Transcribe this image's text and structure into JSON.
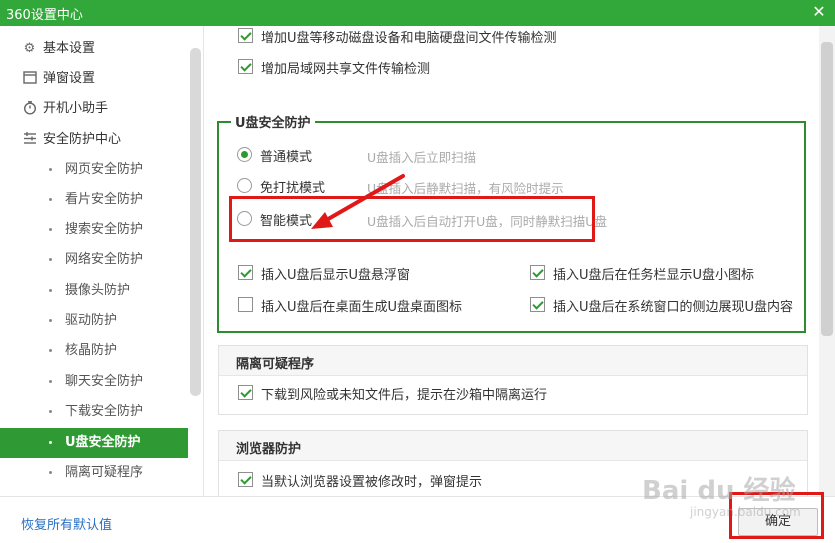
{
  "window": {
    "title": "360设置中心",
    "close_glyph": "✕"
  },
  "sidebar": {
    "top_items": [
      {
        "label": "基本设置",
        "icon": "gear-icon"
      },
      {
        "label": "弹窗设置",
        "icon": "window-icon"
      },
      {
        "label": "开机小助手",
        "icon": "power-timer-icon"
      },
      {
        "label": "安全防护中心",
        "icon": "list-icon"
      }
    ],
    "sub_items": [
      {
        "label": "网页安全防护"
      },
      {
        "label": "看片安全防护"
      },
      {
        "label": "搜索安全防护"
      },
      {
        "label": "网络安全防护"
      },
      {
        "label": "摄像头防护"
      },
      {
        "label": "驱动防护"
      },
      {
        "label": "核晶防护"
      },
      {
        "label": "聊天安全防护"
      },
      {
        "label": "下载安全防护"
      },
      {
        "label": "U盘安全防护",
        "active": true
      },
      {
        "label": "隔离可疑程序"
      }
    ]
  },
  "main": {
    "top_options": [
      {
        "label": "增加U盘等移动磁盘设备和电脑硬盘间文件传输检测",
        "checked": true
      },
      {
        "label": "增加局域网共享文件传输检测",
        "checked": true
      }
    ],
    "usb": {
      "title": "U盘安全防护",
      "modes": [
        {
          "label": "普通模式",
          "hint": "U盘插入后立即扫描",
          "selected": true
        },
        {
          "label": "免打扰模式",
          "hint": "U盘插入后静默扫描，有风险时提示",
          "selected": false
        },
        {
          "label": "智能模式",
          "hint": "U盘插入后自动打开U盘，同时静默扫描U盘",
          "selected": false
        }
      ],
      "options": [
        {
          "label": "插入U盘后显示U盘悬浮窗",
          "checked": true
        },
        {
          "label": "插入U盘后在任务栏显示U盘小图标",
          "checked": true
        },
        {
          "label": "插入U盘后在桌面生成U盘桌面图标",
          "checked": false
        },
        {
          "label": "插入U盘后在系统窗口的侧边展现U盘内容",
          "checked": true
        }
      ]
    },
    "isolate": {
      "title": "隔离可疑程序",
      "option": {
        "label": "下载到风险或未知文件后，提示在沙箱中隔离运行",
        "checked": true
      }
    },
    "browser": {
      "title": "浏览器防护",
      "option": {
        "label": "当默认浏览器设置被修改时，弹窗提示",
        "checked": true
      }
    }
  },
  "footer": {
    "restore_label": "恢复所有默认值",
    "ok_label": "确定"
  },
  "watermark": {
    "logo": "Bai du 经验",
    "url": "jingyan.baidu.com"
  },
  "colors": {
    "brand_green": "#33a83a",
    "active_green": "#2f9a33",
    "highlight_red": "#e01818",
    "link_blue": "#2a6fc2"
  }
}
